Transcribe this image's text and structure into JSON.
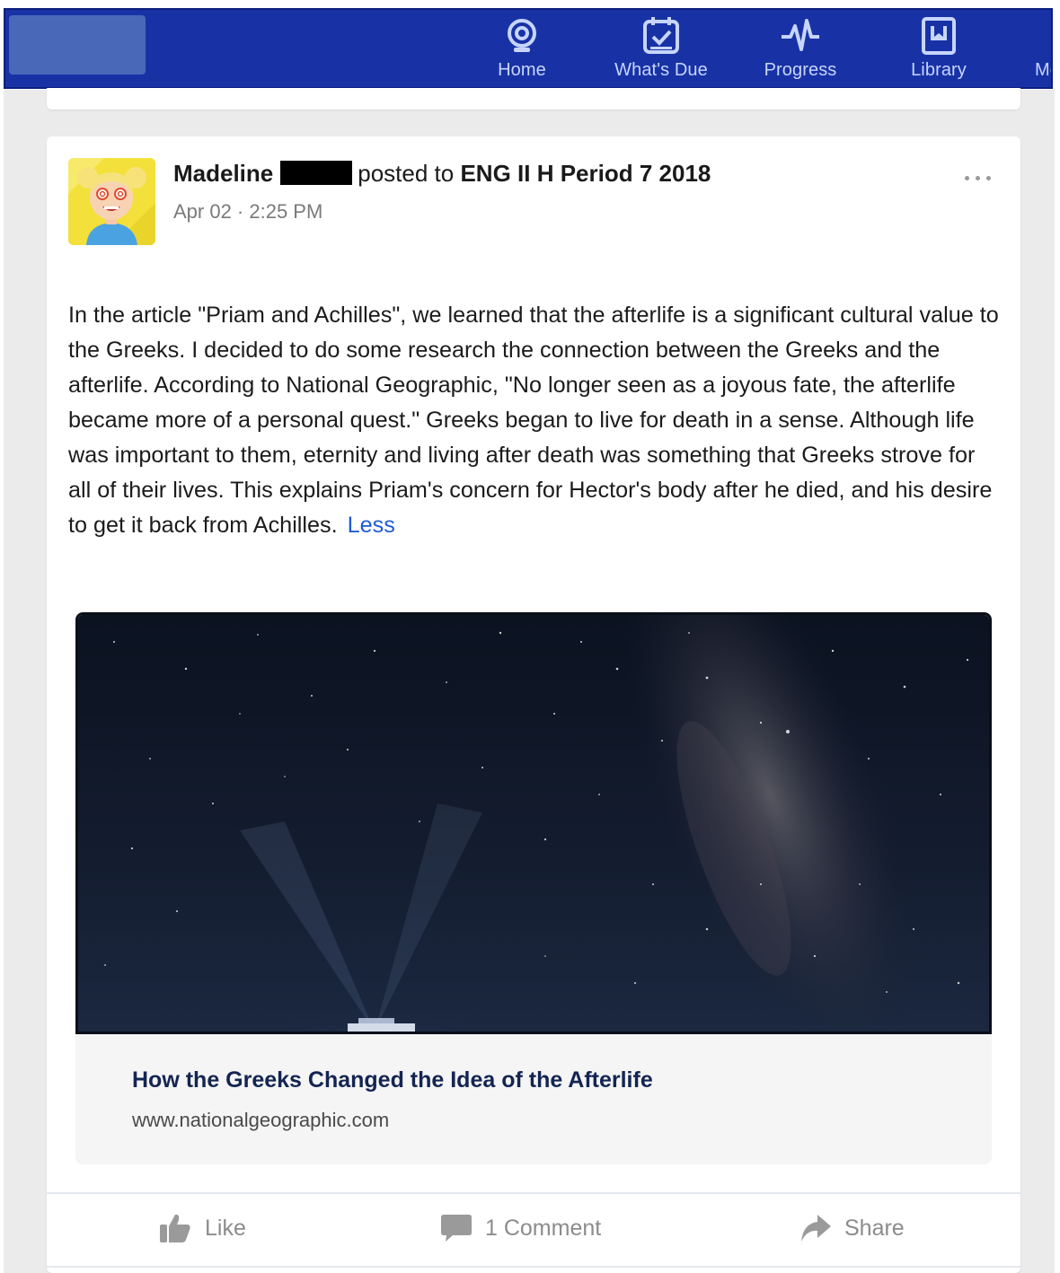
{
  "nav": {
    "items": [
      {
        "label": "Home",
        "icon": "home-icon"
      },
      {
        "label": "What's Due",
        "icon": "calendar-check-icon"
      },
      {
        "label": "Progress",
        "icon": "pulse-icon"
      },
      {
        "label": "Library",
        "icon": "library-icon"
      },
      {
        "label": "Me",
        "icon": "more-nav"
      }
    ]
  },
  "post": {
    "author": "Madeline",
    "posted_to_text": "posted to",
    "group": "ENG II H Period 7 2018",
    "timestamp": "Apr 02 · 2:25 PM",
    "body": "In the article \"Priam and Achilles\", we learned that the afterlife is a significant cultural value to the Greeks. I decided to do some research the connection between the Greeks and the afterlife. According to National Geographic, \"No longer seen as a joyous fate, the afterlife became more of a personal quest.\" Greeks began to live for death in a sense. Although life was important to them, eternity and living after death was something that Greeks strove for all of their lives. This explains Priam's concern for Hector's body after he died, and his desire to get it back from Achilles.",
    "less_label": "Less"
  },
  "link_preview": {
    "title": "How the Greeks Changed the Idea of the Afterlife",
    "domain": "www.nationalgeographic.com"
  },
  "actions": {
    "like_label": "Like",
    "comment_label": "1 Comment",
    "share_label": "Share"
  },
  "colors": {
    "nav_bg": "#1832a6",
    "link": "#1f5bd6",
    "preview_title": "#142552"
  }
}
